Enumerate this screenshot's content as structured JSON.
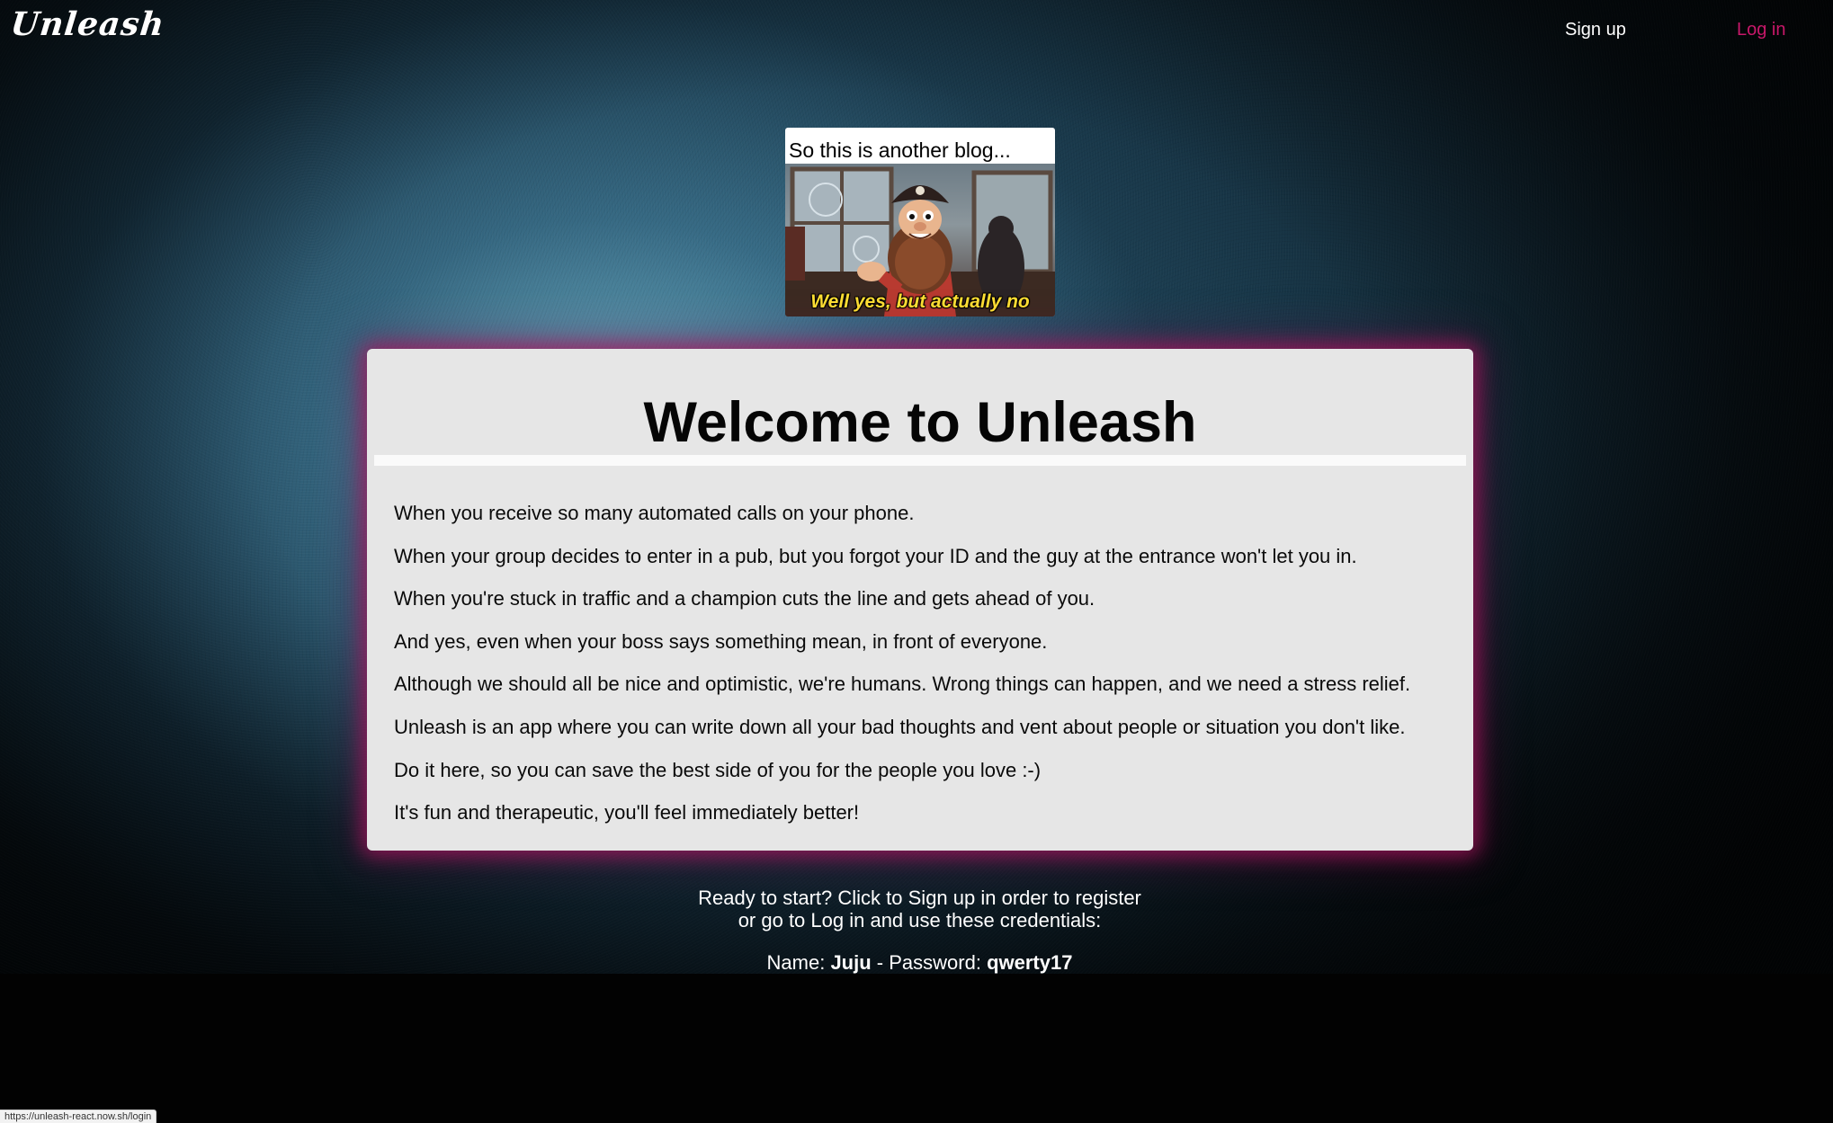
{
  "header": {
    "logo": "Unleash",
    "signup_label": "Sign up",
    "login_label": "Log in"
  },
  "meme": {
    "caption": "So this is another blog...",
    "subtitle": "Well yes, but actually no"
  },
  "welcome": {
    "title": "Welcome to Unleash",
    "paragraphs": [
      "When you receive so many automated calls on your phone.",
      "When your group decides to enter in a pub, but you forgot your ID and the guy at the entrance won't let you in.",
      "When you're stuck in traffic and a champion cuts the line and gets ahead of you.",
      "And yes, even when your boss says something mean, in front of everyone.",
      "Although we should all be nice and optimistic, we're humans. Wrong things can happen, and we need a stress relief.",
      "Unleash is an app where you can write down all your bad thoughts and vent about people or situation you don't like.",
      "Do it here, so you can save the best side of you for the people you love :-)",
      "It's fun and therapeutic, you'll feel immediately better!"
    ]
  },
  "cta": {
    "line1": "Ready to start? Click to Sign up in order to register",
    "line2": "or go to Log in and use these credentials:",
    "name_label": "Name:",
    "name_value": "Juju",
    "separator": "- Password:",
    "password_value": "qwerty17"
  },
  "status_bar": {
    "url": "https://unleash-react.now.sh/login"
  },
  "colors": {
    "login_accent": "#c8186a",
    "card_glow": "#aa145f",
    "subtitle_yellow": "#ffe033"
  }
}
